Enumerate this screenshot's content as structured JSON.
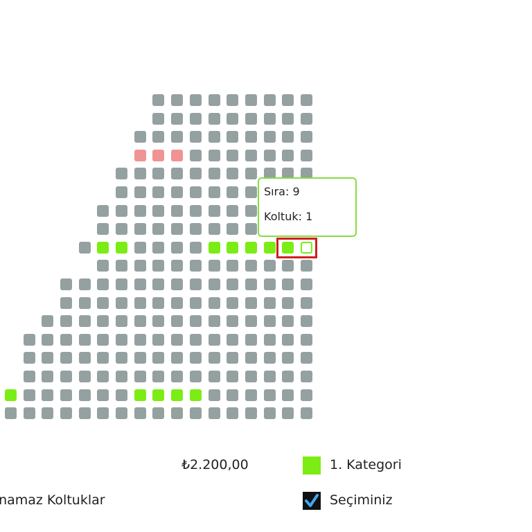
{
  "seat_map": {
    "rows": [
      {
        "row": 1,
        "seats": [
          "u",
          "u",
          "u",
          "u",
          "u",
          "u",
          "u",
          "u",
          "u"
        ]
      },
      {
        "row": 2,
        "seats": [
          "u",
          "u",
          "u",
          "u",
          "u",
          "u",
          "u",
          "u",
          "u"
        ]
      },
      {
        "row": 3,
        "seats": [
          "u",
          "u",
          "u",
          "u",
          "u",
          "u",
          "u",
          "u",
          "u",
          "u"
        ]
      },
      {
        "row": 4,
        "seats": [
          "r",
          "r",
          "r",
          "u",
          "u",
          "u",
          "u",
          "u",
          "u",
          "u"
        ]
      },
      {
        "row": 5,
        "seats": [
          "u",
          "u",
          "u",
          "u",
          "u",
          "u",
          "u",
          "u",
          "u",
          "u",
          "u"
        ]
      },
      {
        "row": 6,
        "seats": [
          "u",
          "u",
          "u",
          "u",
          "u",
          "u",
          "u",
          "u",
          "u",
          "u",
          "u"
        ]
      },
      {
        "row": 7,
        "seats": [
          "u",
          "u",
          "u",
          "u",
          "u",
          "u",
          "u",
          "u",
          "u",
          "u",
          "u",
          "u"
        ]
      },
      {
        "row": 8,
        "seats": [
          "u",
          "u",
          "u",
          "u",
          "u",
          "u",
          "u",
          "u",
          "u",
          "u",
          "u",
          "u"
        ]
      },
      {
        "row": 9,
        "seats": [
          "u",
          "a",
          "a",
          "u",
          "u",
          "u",
          "u",
          "a",
          "a",
          "a",
          "a",
          "a",
          "s"
        ]
      },
      {
        "row": 10,
        "seats": [
          "u",
          "u",
          "u",
          "u",
          "u",
          "u",
          "u",
          "u",
          "u",
          "u",
          "u",
          "u"
        ]
      },
      {
        "row": 11,
        "seats": [
          "u",
          "u",
          "u",
          "u",
          "u",
          "u",
          "u",
          "u",
          "u",
          "u",
          "u",
          "u",
          "u",
          "u"
        ]
      },
      {
        "row": 12,
        "seats": [
          "u",
          "u",
          "u",
          "u",
          "u",
          "u",
          "u",
          "u",
          "u",
          "u",
          "u",
          "u",
          "u",
          "u"
        ]
      },
      {
        "row": 13,
        "seats": [
          "u",
          "u",
          "u",
          "u",
          "u",
          "u",
          "u",
          "u",
          "u",
          "u",
          "u",
          "u",
          "u",
          "u",
          "u"
        ]
      },
      {
        "row": 14,
        "seats": [
          "u",
          "u",
          "u",
          "u",
          "u",
          "u",
          "u",
          "u",
          "u",
          "u",
          "u",
          "u",
          "u",
          "u",
          "u",
          "u"
        ]
      },
      {
        "row": 15,
        "seats": [
          "u",
          "u",
          "u",
          "u",
          "u",
          "u",
          "u",
          "u",
          "u",
          "u",
          "u",
          "u",
          "u",
          "u",
          "u",
          "u"
        ]
      },
      {
        "row": 16,
        "seats": [
          "u",
          "u",
          "u",
          "u",
          "u",
          "u",
          "u",
          "u",
          "u",
          "u",
          "u",
          "u",
          "u",
          "u",
          "u",
          "u"
        ]
      },
      {
        "row": 17,
        "seats": [
          "a",
          "u",
          "u",
          "u",
          "u",
          "u",
          "u",
          "a",
          "a",
          "a",
          "a",
          "u",
          "u",
          "u",
          "u",
          "u",
          "u"
        ]
      },
      {
        "row": 18,
        "seats": [
          "u",
          "u",
          "u",
          "u",
          "u",
          "u",
          "u",
          "u",
          "u",
          "u",
          "u",
          "u",
          "u",
          "u",
          "u",
          "u",
          "u"
        ]
      }
    ],
    "status_legend": {
      "a": "available",
      "u": "unavailable",
      "r": "reserved",
      "s": "selected"
    }
  },
  "tooltip": {
    "row_text": "Sıra: 9",
    "seat_text": "Koltuk: 1"
  },
  "price": "₺2.200,00",
  "legend": {
    "category_label": "1. Kategori",
    "selection_label": "Seçiminiz",
    "unavailable_label": "Satın Alınamaz Koltuklar"
  },
  "colors": {
    "available": "#7ced14",
    "unavailable": "#95a1a1",
    "reserved": "#f09394",
    "selected_border": "#7ced14",
    "highlight": "#d21e1e",
    "tooltip_border": "#86dc43"
  },
  "icons": {
    "selection": "checkmark-icon"
  }
}
